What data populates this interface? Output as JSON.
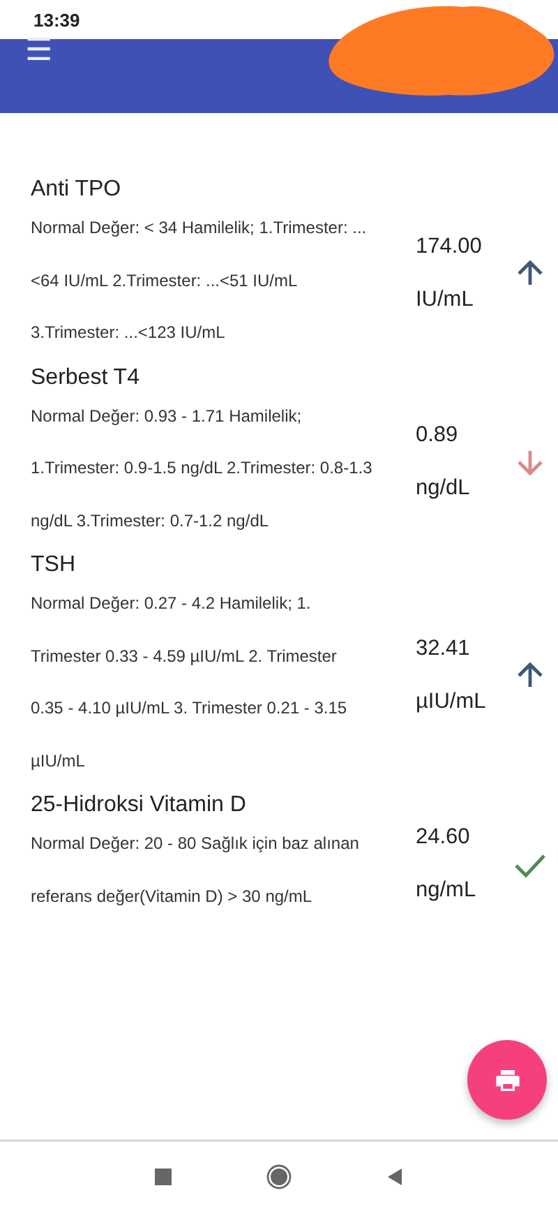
{
  "status_bar": {
    "time": "13:39"
  },
  "app_bar": {
    "menu_icon": "☰"
  },
  "tests": [
    {
      "name": "Anti TPO",
      "note_lines": [
        "Normal Değer: < 34 Hamilelik; 1.Trimester: ...",
        "<64 IU/mL 2.Trimester: ...<51 IU/mL",
        "3.Trimester: ...<123 IU/mL"
      ],
      "value": "174.00",
      "unit": "IU/mL",
      "kind": "high"
    },
    {
      "name": "Serbest T4",
      "note_lines": [
        "Normal Değer: 0.93 - 1.71 Hamilelik;",
        "1.Trimester: 0.9-1.5 ng/dL 2.Trimester: 0.8-1.3",
        "ng/dL 3.Trimester: 0.7-1.2 ng/dL"
      ],
      "value": "0.89",
      "unit": "ng/dL",
      "kind": "low"
    },
    {
      "name": "TSH",
      "note_lines": [
        "Normal Değer: 0.27 - 4.2 Hamilelik; 1.",
        "Trimester 0.33 - 4.59 µIU/mL 2. Trimester",
        "0.35 - 4.10 µIU/mL 3. Trimester 0.21 - 3.15",
        "µIU/mL"
      ],
      "value": "32.41",
      "unit": "µIU/mL",
      "kind": "high"
    },
    {
      "name": "25-Hidroksi Vitamin D",
      "note_lines": [
        "Normal Değer: 20 - 80 Sağlık için baz alınan",
        "referans değer(Vitamin D) > 30 ng/mL"
      ],
      "value": "24.60",
      "unit": "ng/mL",
      "kind": "normal"
    }
  ]
}
